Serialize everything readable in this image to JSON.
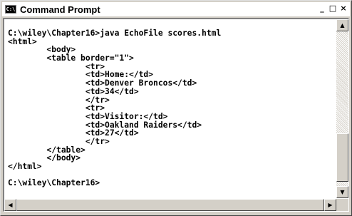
{
  "window": {
    "title": "Command Prompt",
    "icon_label": "C:\\",
    "buttons": {
      "minimize": "_",
      "maximize": "□",
      "close": "×"
    }
  },
  "console": {
    "lines": [
      "C:\\wiley\\Chapter16>java EchoFile scores.html",
      "<html>",
      "        <body>",
      "        <table border=\"1\">",
      "                <tr>",
      "                <td>Home:</td>",
      "                <td>Denver Broncos</td>",
      "                <td>34</td>",
      "                </tr>",
      "                <tr>",
      "                <td>Visitor:</td>",
      "                <td>Oakland Raiders</td>",
      "                <td>27</td>",
      "                </tr>",
      "        </table>",
      "        </body>",
      "</html>",
      "",
      "C:\\wiley\\Chapter16>"
    ]
  },
  "scrollbars": {
    "up_arrow": "▲",
    "down_arrow": "▼",
    "left_arrow": "◀",
    "right_arrow": "▶"
  },
  "colors": {
    "titlebar_bg": "#ffffff",
    "console_bg": "#ffffff",
    "console_text": "#000000",
    "chrome": "#d4d0c8"
  }
}
